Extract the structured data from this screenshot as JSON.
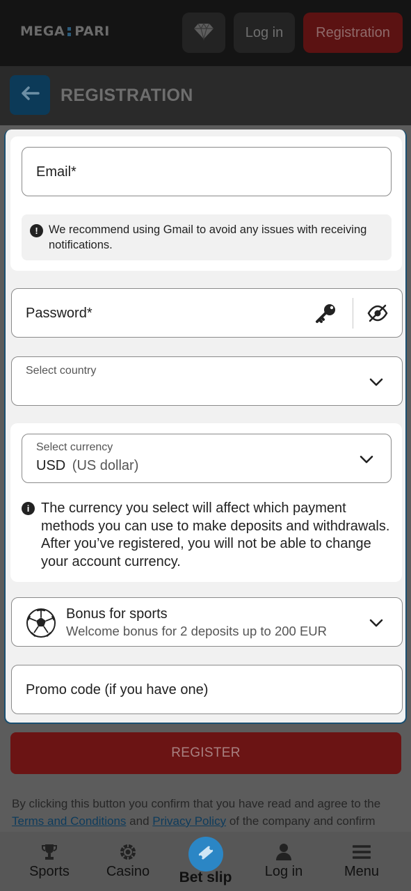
{
  "header": {
    "logo_left": "MEGA",
    "logo_right": "PARI",
    "diamond_icon": "diamond-icon",
    "login_label": "Log in",
    "registration_label": "Registration"
  },
  "titlebar": {
    "back_icon": "arrow-left-icon",
    "title": "REGISTRATION"
  },
  "form": {
    "email_label": "Email*",
    "email_hint": "We recommend using Gmail to avoid any issues with receiving notifications.",
    "password_label": "Password*",
    "password_icons": [
      "key-icon",
      "eye-off-icon"
    ],
    "country_label": "Select country",
    "currency_label": "Select currency",
    "currency_code": "USD",
    "currency_name": "(US dollar)",
    "currency_hint": "The currency you select will affect which payment methods you can use to make deposits and withdrawals. After you’ve registered, you will not be able to change your account currency.",
    "bonus_title": "Bonus for sports",
    "bonus_subtitle": "Welcome bonus for 2 deposits up to 200 EUR",
    "promo_label": "Promo code (if you have one)"
  },
  "register_button": "REGISTER",
  "terms": {
    "prefix": "By clicking this button you confirm that you have read and agree to the",
    "terms_link": "Terms and Conditions",
    "and": "and",
    "privacy_link": "Privacy Policy",
    "suffix": "of the company and confirm"
  },
  "bottom_nav": {
    "sports": "Sports",
    "casino": "Casino",
    "bet_slip": "Bet slip",
    "log_in": "Log in",
    "menu": "Menu"
  },
  "colors": {
    "accent_blue": "#2b86c5",
    "brand_red": "#6b1414",
    "header_bg": "#141414"
  }
}
